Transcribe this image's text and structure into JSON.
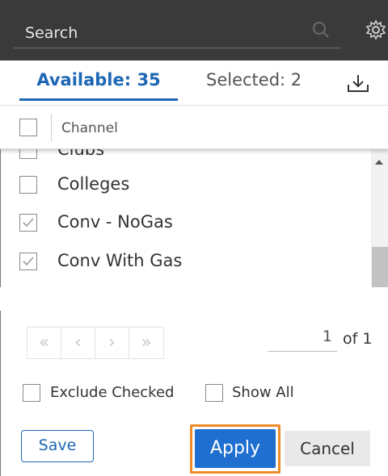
{
  "search": {
    "label": "Search"
  },
  "tabs": {
    "available": "Available: 35",
    "selected": "Selected: 2"
  },
  "column": {
    "header": "Channel"
  },
  "rows": [
    {
      "label": "Clubs",
      "checked": false
    },
    {
      "label": "Colleges",
      "checked": false
    },
    {
      "label": "Conv - NoGas",
      "checked": true
    },
    {
      "label": "Conv With Gas",
      "checked": true
    }
  ],
  "pager": {
    "first": "«",
    "prev": "‹",
    "next": "›",
    "last": "»",
    "page": "1",
    "of": "of 1"
  },
  "options": {
    "exclude_checked": "Exclude Checked",
    "show_all": "Show All"
  },
  "buttons": {
    "save": "Save",
    "apply": "Apply",
    "cancel": "Cancel"
  },
  "colors": {
    "accent": "#1d67b5",
    "apply": "#1f6fd0",
    "highlight": "#f08a28",
    "search_bg": "#3a3a3a"
  },
  "icons": [
    "search-icon",
    "gear-icon",
    "download-icon",
    "check-icon",
    "scroll-up-icon"
  ]
}
